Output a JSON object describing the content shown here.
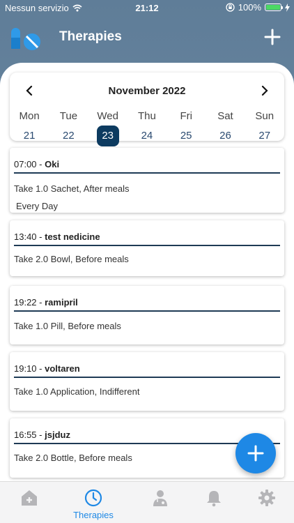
{
  "status_bar": {
    "carrier": "Nessun servizio",
    "time": "21:12",
    "battery": "100%",
    "battery_level": 1.0
  },
  "header": {
    "title": "Therapies",
    "logo_icon": "pills-icon",
    "add_icon": "plus-icon"
  },
  "calendar": {
    "month": "November 2022",
    "days": [
      {
        "name": "Mon",
        "num": "21"
      },
      {
        "name": "Tue",
        "num": "22"
      },
      {
        "name": "Wed",
        "num": "23"
      },
      {
        "name": "Thu",
        "num": "24"
      },
      {
        "name": "Fri",
        "num": "25"
      },
      {
        "name": "Sat",
        "num": "26"
      },
      {
        "name": "Sun",
        "num": "27"
      }
    ],
    "selected": "23"
  },
  "therapies": [
    {
      "time": "07:00",
      "sep": " - ",
      "name": "Oki",
      "dose": "Take 1.0 Sachet, After meals",
      "freq": "Every Day"
    },
    {
      "time": "13:40",
      "sep": " - ",
      "name": "test nedicine",
      "dose": "Take 2.0 Bowl, Before meals"
    },
    {
      "time": "19:22",
      "sep": " - ",
      "name": "ramipril",
      "dose": "Take 1.0 Pill, Before meals"
    },
    {
      "time": "19:10",
      "sep": " - ",
      "name": "voltaren",
      "dose": "Take 1.0 Application, Indifferent"
    },
    {
      "time": "16:55",
      "sep": " - ",
      "name": "jsjduz",
      "dose": "Take 2.0 Bottle, Before meals"
    }
  ],
  "tabbar": {
    "tabs": [
      {
        "icon": "home-plus-icon",
        "label": ""
      },
      {
        "icon": "clock-icon",
        "label": "Therapies"
      },
      {
        "icon": "doctor-icon",
        "label": ""
      },
      {
        "icon": "bell-icon",
        "label": ""
      },
      {
        "icon": "gear-icon",
        "label": ""
      }
    ]
  },
  "colors": {
    "accent": "#1e88e5",
    "navy": "#0d3b60",
    "inactive_tab": "#b5b5b8"
  }
}
